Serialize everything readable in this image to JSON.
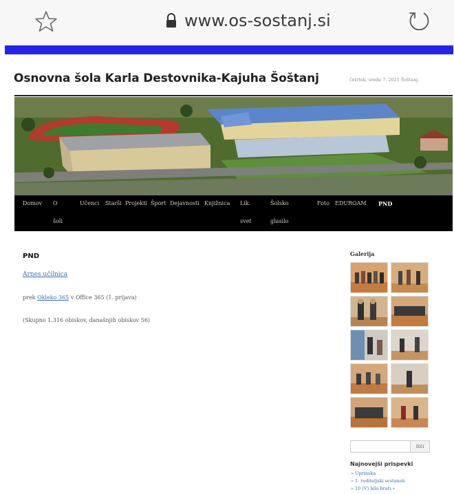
{
  "browser": {
    "url": "www.os-sostanj.si",
    "star_icon": "star-icon",
    "lock_icon": "lock-icon",
    "reload_icon": "reload-icon"
  },
  "site": {
    "title": "Osnovna šola Karla Destovnika-Kajuha Šoštanj",
    "date": "četrtek, sreda 7. 2021 Šoštanj"
  },
  "nav": {
    "items": [
      {
        "label": "Domov"
      },
      {
        "label": "O"
      },
      {
        "label": "šoli"
      },
      {
        "label": "Učenci"
      },
      {
        "label": "Starši"
      },
      {
        "label": "Projekti"
      },
      {
        "label": "Šport"
      },
      {
        "label": "Dejavnosti"
      },
      {
        "label": "Knjižnica"
      },
      {
        "label": "Lik."
      },
      {
        "label": "svet"
      },
      {
        "label": "Šolsko"
      },
      {
        "label": "glasilo"
      },
      {
        "label": "Foto"
      },
      {
        "label": "EDUROAM"
      },
      {
        "label": "PND"
      }
    ]
  },
  "content": {
    "title": "PND",
    "link": "Arnes učilnica",
    "line2_prefix": "prek",
    "line2_link": "Okleko 365",
    "line2_suffix": "v Office 365 (1. prijava)",
    "line3": "(Skupno 1.316 obiskov, današnjih obiskov 56)"
  },
  "sidebar": {
    "gallery_title": "Galerija",
    "search_placeholder": "",
    "search_button": "Išči",
    "recent_title": "Najnovejši prispevki",
    "recent": [
      "» Uprinska",
      "» 1. roditeljski sestanek",
      "» 10 (V) bilo brati »"
    ]
  },
  "colors": {
    "accent_bar": "#2323f0",
    "nav_bg": "#000000",
    "link": "#3a6fb0"
  }
}
